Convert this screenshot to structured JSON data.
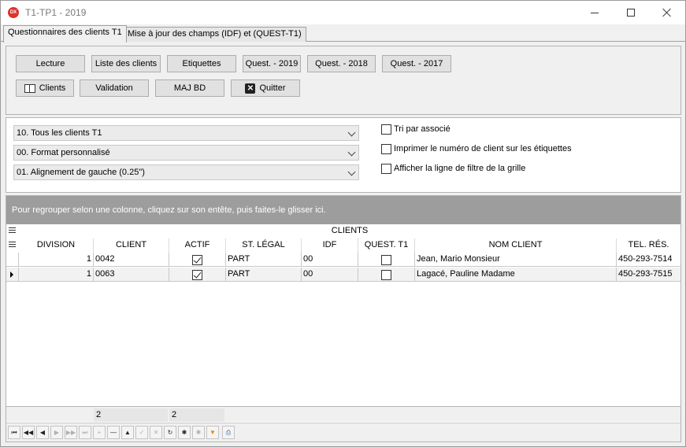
{
  "window": {
    "title": "T1-TP1 - 2019",
    "logo_text": "DX",
    "minimize_icon": "minimize-icon",
    "maximize_icon": "maximize-icon",
    "close_icon": "close-icon"
  },
  "tabs": [
    {
      "label": "Questionnaires des clients T1",
      "active": true
    },
    {
      "label": "Mise à jour des champs  (IDF) et (QUEST-T1)",
      "active": false
    }
  ],
  "buttons": {
    "lecture": "Lecture",
    "liste_clients": "Liste des clients",
    "etiquettes": "Etiquettes",
    "quest_2019": "Quest. - 2019",
    "quest_2018": "Quest. - 2018",
    "quest_2017": "Quest. - 2017",
    "clients": "Clients",
    "validation": "Validation",
    "maj_bd": "MAJ BD",
    "quitter": "Quitter"
  },
  "combos": [
    {
      "value": "10. Tous les clients T1"
    },
    {
      "value": "00. Format personnalisé"
    },
    {
      "value": "01. Alignement de gauche (0.25\")"
    }
  ],
  "options": [
    {
      "label": "Tri par associé",
      "checked": false
    },
    {
      "label": "Imprimer le numéro de client sur les étiquettes",
      "checked": false
    },
    {
      "label": "Afficher la ligne de filtre de la grille",
      "checked": false
    }
  ],
  "grid": {
    "group_panel_text": "Pour regrouper selon une colonne, cliquez sur son entête, puis faites-le glisser ici.",
    "band_title": "CLIENTS",
    "columns": [
      "DIVISION",
      "CLIENT",
      "ACTIF",
      "ST. LÉGAL",
      "IDF",
      "QUEST. T1",
      "NOM CLIENT",
      "TEL. RÉS."
    ],
    "rows": [
      {
        "division": "1",
        "client": "0042",
        "actif": true,
        "st_legal": "PART",
        "idf": "00",
        "quest_t1": false,
        "nom_client": "Jean, Mario Monsieur",
        "tel_res": "450-293-7514",
        "focused": false
      },
      {
        "division": "1",
        "client": "0063",
        "actif": true,
        "st_legal": "PART",
        "idf": "00",
        "quest_t1": false,
        "nom_client": "Lagacé, Pauline Madame",
        "tel_res": "450-293-7515",
        "focused": true
      }
    ],
    "footer": {
      "client_count": "2",
      "actif_count": "2"
    }
  },
  "navigator": [
    "first-icon",
    "prev-page-icon",
    "prev-icon",
    "next-icon",
    "next-page-icon",
    "last-icon",
    "insert-icon",
    "delete-icon",
    "edit-icon",
    "post-icon",
    "cancel-icon",
    "refresh-icon",
    "save-bookmark-icon",
    "goto-bookmark-icon",
    "filter-icon",
    "print-icon"
  ]
}
